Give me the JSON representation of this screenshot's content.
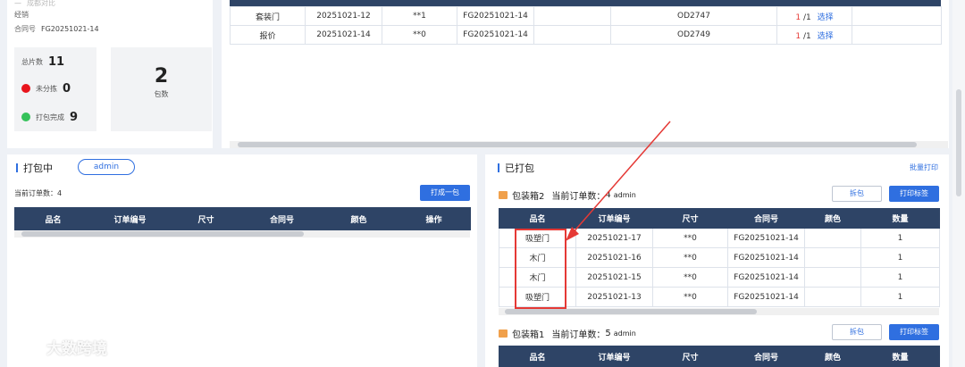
{
  "info": {
    "row1_value": "成都对比",
    "row2_label": "经销",
    "row3_label": "合同号",
    "row3_value": "FG20251021-14"
  },
  "stats": {
    "total_label": "总片数",
    "total_value": "11",
    "unsorted_label": "未分拣",
    "unsorted_value": "0",
    "packed_label": "打包完成",
    "packed_value": "9",
    "packs_value": "2",
    "packs_label": "包数",
    "red": "#e8141c",
    "green": "#35c25a"
  },
  "top_table": {
    "rows": [
      {
        "name": "套装门",
        "order": "20251021-12",
        "size": "**1",
        "contract": "FG20251021-14",
        "code": "OD2747",
        "count_cur": "1",
        "count_total": " /1",
        "action": "选择"
      },
      {
        "name": "报价",
        "order": "20251021-14",
        "size": "**0",
        "contract": "FG20251021-14",
        "code": "OD2749",
        "count_cur": "1",
        "count_total": " /1",
        "action": "选择"
      }
    ]
  },
  "packing": {
    "title": "打包中",
    "user": "admin",
    "order_count_label": "当前订单数：4",
    "pack_button": "打成一包",
    "columns": [
      "品名",
      "订单编号",
      "尺寸",
      "合同号",
      "颜色",
      "操作"
    ]
  },
  "packed": {
    "title": "已打包",
    "batch_print": "批量打印",
    "columns": [
      "品名",
      "订单编号",
      "尺寸",
      "合同号",
      "颜色",
      "数量"
    ],
    "box2": {
      "title": "包装箱2",
      "count_label": "当前订单数：",
      "count": "4",
      "user": "admin",
      "unpack": "拆包",
      "print": "打印标签",
      "rows": [
        {
          "name": "吸塑门",
          "order": "20251021-17",
          "size": "**0",
          "contract": "FG20251021-14",
          "color": "",
          "qty": "1"
        },
        {
          "name": "木门",
          "order": "20251021-16",
          "size": "**0",
          "contract": "FG20251021-14",
          "color": "",
          "qty": "1"
        },
        {
          "name": "木门",
          "order": "20251021-15",
          "size": "**0",
          "contract": "FG20251021-14",
          "color": "",
          "qty": "1"
        },
        {
          "name": "吸塑门",
          "order": "20251021-13",
          "size": "**0",
          "contract": "FG20251021-14",
          "color": "",
          "qty": "1"
        }
      ]
    },
    "box1": {
      "title": "包装箱1",
      "count_label": "当前订单数：",
      "count": "5",
      "user": "admin",
      "unpack": "拆包",
      "print": "打印标签"
    }
  },
  "watermark": "大数跨境",
  "colors": {
    "accent": "#2f6fe0",
    "table_head": "#2e4466",
    "highlight": "#e53935"
  }
}
